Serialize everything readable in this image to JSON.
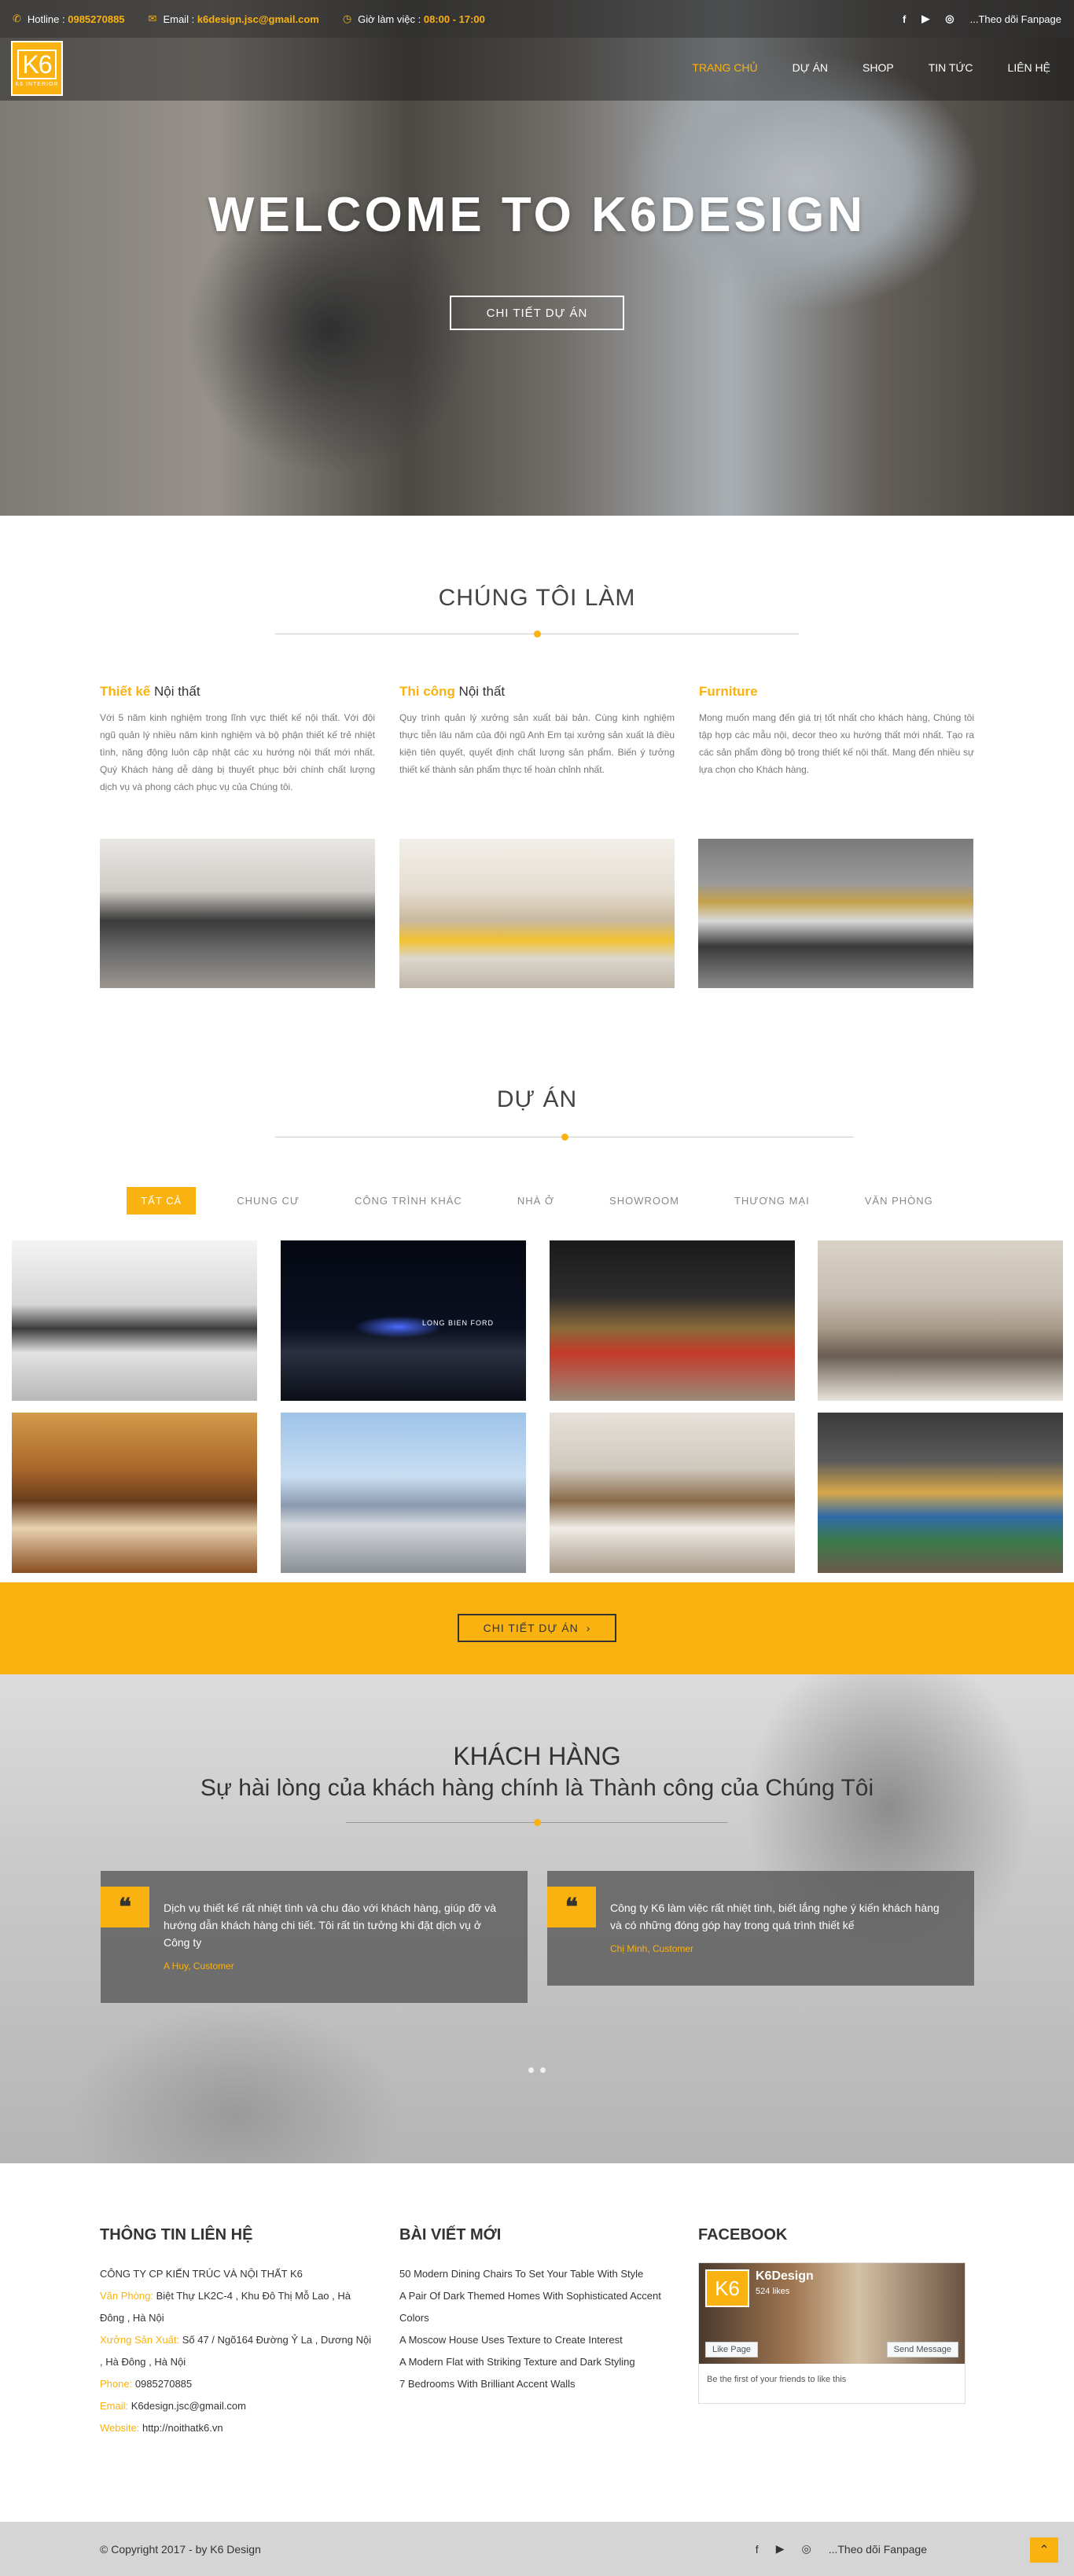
{
  "topbar": {
    "hotline_label": "Hotline :",
    "hotline": "0985270885",
    "email_label": "Email :",
    "email": "k6design.jsc@gmail.com",
    "hours_label": "Giờ làm việc :",
    "hours": "08:00 - 17:00",
    "fanpage": "...Theo dõi Fanpage"
  },
  "logo": {
    "text": "K6",
    "sub": "K6 INTERIOR"
  },
  "nav": [
    "TRANG CHỦ",
    "DỰ ÁN",
    "SHOP",
    "TIN TỨC",
    "LIÊN HỆ"
  ],
  "hero": {
    "title": "WELCOME TO K6DESIGN",
    "button": "CHI TIẾT DỰ ÁN"
  },
  "services": {
    "title": "CHÚNG TÔI LÀM",
    "items": [
      {
        "title_hl": "Thiết kế",
        "title_rest": " Nội thất",
        "text": "Với 5 năm kinh nghiệm trong lĩnh vực thiết kế nội thất. Với đội ngũ quản lý nhiều năm kinh nghiệm và bộ phận thiết kế trẻ nhiệt tình, năng động luôn cập nhật các xu hướng nội thất mới nhất. Quý Khách hàng dễ dàng bị thuyết phục bởi chính chất lượng dịch vụ và phong cách phục vụ của Chúng tôi."
      },
      {
        "title_hl": "Thi công",
        "title_rest": " Nội thất",
        "text": "Quy trình quản lý xưởng sản xuất bài bản. Cùng kinh nghiệm thực tiễn lâu năm của đội ngũ Anh Em tại xưởng sản xuất là điều kiện tiên quyết, quyết định chất lượng sản phẩm. Biến ý tưởng thiết kế thành sản phẩm thực tế hoàn chỉnh nhất."
      },
      {
        "title_hl": "Furniture",
        "title_rest": "",
        "text": "Mong muốn mang đến giá trị tốt nhất cho khách hàng, Chúng tôi tập hợp các mẫu nội, decor theo xu hướng thất mới nhất. Tạo ra các sản phẩm đồng bộ trong thiết kế nội thất. Mang đến nhiều sự lựa chọn cho Khách hàng."
      }
    ]
  },
  "projects": {
    "title": "DỰ ÁN",
    "filters": [
      "TẤT CẢ",
      "CHUNG CƯ",
      "CÔNG TRÌNH KHÁC",
      "NHÀ Ở",
      "SHOWROOM",
      "THƯƠNG MẠI",
      "VĂN PHÒNG"
    ],
    "sign_text": "LONG BIEN FORD",
    "cta": "CHI TIẾT DỰ ÁN"
  },
  "testimonials": {
    "title": "KHÁCH HÀNG",
    "subtitle": "Sự hài lòng của khách hàng chính là Thành công của Chúng Tôi",
    "items": [
      {
        "text": "Dịch vụ thiết kế rất nhiệt tình và chu đáo với khách hàng, giúp đỡ và hướng dẫn khách hàng chi tiết. Tôi rất tin tưởng khi đặt dịch vụ ở Công ty",
        "author": "A Huy, Customer"
      },
      {
        "text": "Công ty K6 làm việc rất nhiệt tình, biết lắng nghe ý kiến khách hàng và có những đóng góp hay trong quá trình thiết kế",
        "author": "Chị Minh, Customer"
      }
    ]
  },
  "contact": {
    "title": "THÔNG TIN LIÊN HỆ",
    "company": "CÔNG TY CP KIẾN TRÚC VÀ NỘI THẤT K6",
    "office_label": "Văn Phòng:",
    "office": "Biệt Thự LK2C-4 , Khu Đô Thị Mỗ Lao , Hà Đông , Hà Nội",
    "factory_label": "Xưởng Sản Xuất:",
    "factory": "Số 47 / Ngõ164 Đường Ỷ La , Dương Nội , Hà Đông , Hà Nội",
    "phone_label": "Phone:",
    "phone": "0985270885",
    "email_label": "Email:",
    "email": "K6design.jsc@gmail.com",
    "website_label": "Website:",
    "website": "http://noithatk6.vn"
  },
  "posts": {
    "title": "BÀI VIẾT MỚI",
    "items": [
      "50 Modern Dining Chairs To Set Your Table With Style",
      "A Pair Of Dark Themed Homes With Sophisticated Accent Colors",
      "A Moscow House Uses Texture to Create Interest",
      "A Modern Flat with Striking Texture and Dark Styling",
      "7 Bedrooms With Brilliant Accent Walls"
    ]
  },
  "facebook": {
    "title": "FACEBOOK",
    "page_name": "K6Design",
    "likes": "524 likes",
    "like_btn": "Like Page",
    "msg_btn": "Send Message",
    "note": "Be the first of your friends to like this"
  },
  "footer": {
    "copyright": "© Copyright 2017 - by K6 Design",
    "fanpage": "...Theo dõi Fanpage"
  },
  "colors": {
    "accent": "#f9b20f"
  }
}
